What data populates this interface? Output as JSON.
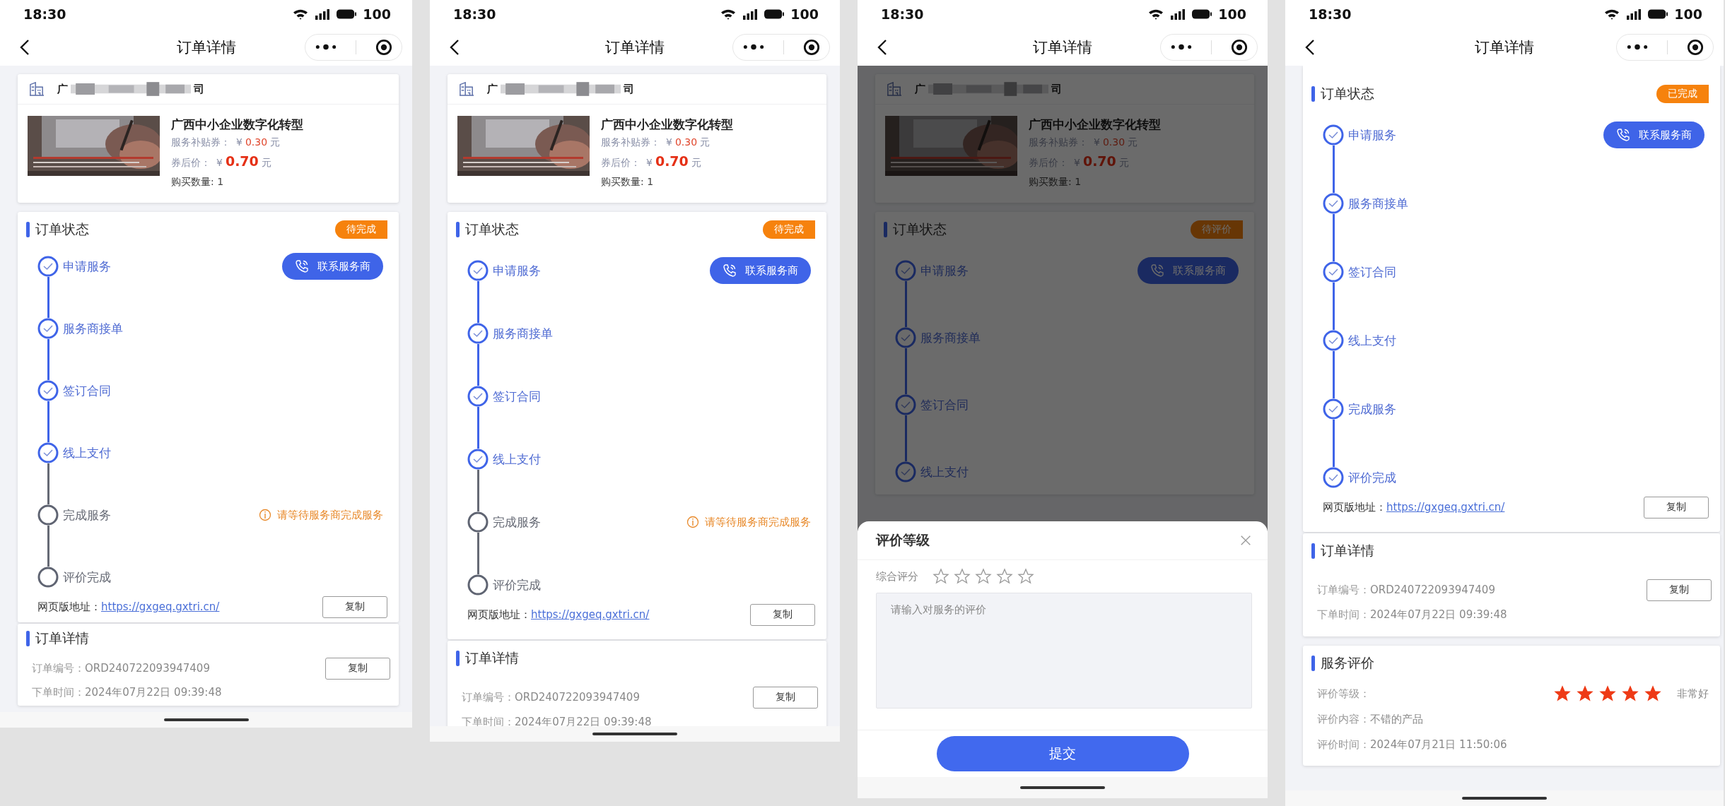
{
  "screens": [
    {
      "status_bar": {
        "time": "18:30",
        "battery": "100"
      },
      "nav": {
        "title": "订单详情"
      },
      "product": {
        "company_start": "广",
        "company_end": "司",
        "title": "广西中小企业数字化转型",
        "subsidy_label": "服务补贴券：",
        "subsidy_currency": "¥",
        "subsidy_value": "0.30",
        "subsidy_unit": "元",
        "price_label": "券后价：",
        "price_currency": "¥",
        "price_value": "0.70",
        "price_unit": "元",
        "quantity": "购买数量: 1"
      },
      "order_status": {
        "heading": "订单状态",
        "badge": "待完成",
        "contact_button": "联系服务商",
        "steps": [
          {
            "label": "申请服务",
            "done": true
          },
          {
            "label": "服务商接单",
            "done": true
          },
          {
            "label": "签订合同",
            "done": true
          },
          {
            "label": "线上支付",
            "done": true
          },
          {
            "label": "完成服务",
            "done": false,
            "notice": "请等待服务商完成服务"
          },
          {
            "label": "评价完成",
            "done": false
          }
        ],
        "url_label": "网页版地址：",
        "url": "https://gxgeq.gxtri.cn/",
        "copy_button": "复制"
      },
      "order_details": {
        "heading": "订单详情",
        "order_no_label": "订单编号：",
        "order_no": "ORD240722093947409",
        "copy_button": "复制",
        "time_label": "下单时间：",
        "time": "2024年07月22日 09:39:48"
      }
    },
    {
      "status_bar": {
        "time": "18:30",
        "battery": "100"
      },
      "nav": {
        "title": "订单详情"
      },
      "product": {
        "company_start": "广",
        "company_end": "司",
        "title": "广西中小企业数字化转型",
        "subsidy_label": "服务补贴券：",
        "subsidy_currency": "¥",
        "subsidy_value": "0.30",
        "subsidy_unit": "元",
        "price_label": "券后价：",
        "price_currency": "¥",
        "price_value": "0.70",
        "price_unit": "元",
        "quantity": "购买数量: 1"
      },
      "order_status": {
        "heading": "订单状态",
        "badge": "待完成",
        "contact_button": "联系服务商",
        "steps": [
          {
            "label": "申请服务",
            "done": true
          },
          {
            "label": "服务商接单",
            "done": true
          },
          {
            "label": "签订合同",
            "done": true
          },
          {
            "label": "线上支付",
            "done": true
          },
          {
            "label": "完成服务",
            "done": false,
            "notice": "请等待服务商完成服务"
          },
          {
            "label": "评价完成",
            "done": false
          }
        ],
        "url_label": "网页版地址：",
        "url": "https://gxgeq.gxtri.cn/",
        "copy_button": "复制"
      },
      "order_details": {
        "heading": "订单详情",
        "order_no_label": "订单编号：",
        "order_no": "ORD240722093947409",
        "copy_button": "复制",
        "time_label": "下单时间：",
        "time": "2024年07月22日 09:39:48"
      }
    },
    {
      "status_bar": {
        "time": "18:30",
        "battery": "100"
      },
      "nav": {
        "title": "订单详情"
      },
      "product": {
        "company_start": "广",
        "company_end": "司",
        "title": "广西中小企业数字化转型",
        "subsidy_label": "服务补贴券：",
        "subsidy_currency": "¥",
        "subsidy_value": "0.30",
        "subsidy_unit": "元",
        "price_label": "券后价：",
        "price_currency": "¥",
        "price_value": "0.70",
        "price_unit": "元",
        "quantity": "购买数量: 1"
      },
      "order_status": {
        "heading": "订单状态",
        "badge": "待评价",
        "contact_button": "联系服务商",
        "steps": [
          {
            "label": "申请服务",
            "done": true
          },
          {
            "label": "服务商接单",
            "done": true
          },
          {
            "label": "签订合同",
            "done": true
          },
          {
            "label": "线上支付",
            "done": true
          }
        ]
      },
      "sheet": {
        "title": "评价等级",
        "rating_label": "综合评分",
        "stars": 0,
        "placeholder": "请输入对服务的评价",
        "submit": "提交"
      }
    },
    {
      "status_bar": {
        "time": "18:30",
        "battery": "100"
      },
      "nav": {
        "title": "订单详情"
      },
      "order_status": {
        "heading": "订单状态",
        "badge": "已完成",
        "contact_button": "联系服务商",
        "steps": [
          {
            "label": "申请服务",
            "done": true
          },
          {
            "label": "服务商接单",
            "done": true
          },
          {
            "label": "签订合同",
            "done": true
          },
          {
            "label": "线上支付",
            "done": true
          },
          {
            "label": "完成服务",
            "done": true
          },
          {
            "label": "评价完成",
            "done": true
          }
        ],
        "url_label": "网页版地址：",
        "url": "https://gxgeq.gxtri.cn/",
        "copy_button": "复制"
      },
      "order_details": {
        "heading": "订单详情",
        "order_no_label": "订单编号：",
        "order_no": "ORD240722093947409",
        "copy_button": "复制",
        "time_label": "下单时间：",
        "time": "2024年07月22日 09:39:48"
      },
      "review": {
        "heading": "服务评价",
        "rating_label": "评价等级：",
        "stars": 5,
        "rating_text": "非常好",
        "content_label": "评价内容：",
        "content": "不错的产品",
        "time_label": "评价时间：",
        "time": "2024年07月21日 11:50:06"
      }
    }
  ]
}
